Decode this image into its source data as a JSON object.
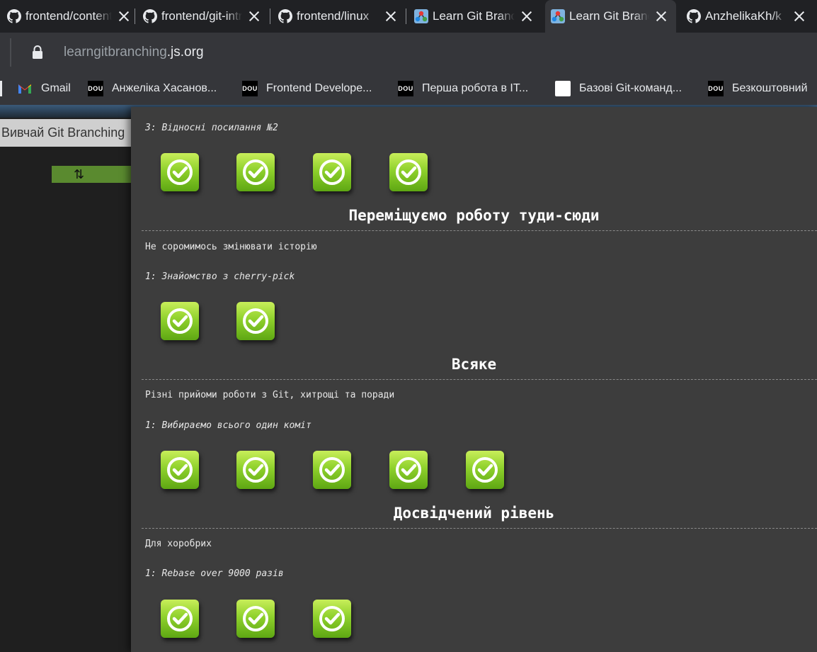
{
  "tabs": [
    {
      "title": "frontend/content",
      "icon": "github-icon",
      "active": false
    },
    {
      "title": "frontend/git-intro",
      "icon": "github-icon",
      "active": false
    },
    {
      "title": "frontend/linux",
      "icon": "github-icon",
      "active": false
    },
    {
      "title": "Learn Git Branching",
      "icon": "learngitbranching-icon",
      "active": false
    },
    {
      "title": "Learn Git Branching",
      "icon": "learngitbranching-icon",
      "active": true
    },
    {
      "title": "AnzhelikaKh/k",
      "icon": "github-icon",
      "active": false
    }
  ],
  "address": {
    "host": "learngitbranching",
    "domain": ".js.org"
  },
  "bookmarks": [
    {
      "label": "Gmail",
      "icon": "gmail-icon"
    },
    {
      "label": "Анжеліка Хасанов...",
      "icon": "dou-icon"
    },
    {
      "label": "Frontend Develope...",
      "icon": "dou-icon"
    },
    {
      "label": "Перша робота в IT...",
      "icon": "dou-icon"
    },
    {
      "label": "Базові Git-команд...",
      "icon": "document-icon"
    },
    {
      "label": "Безкоштовний",
      "icon": "dou-icon"
    }
  ],
  "dou_text": "DOU",
  "sidebar": {
    "title": "Вивчай Git Branching",
    "button_glyph": "⇅"
  },
  "panel": {
    "level_top": "3: Відносні посилання №2",
    "sections": [
      {
        "title": "Переміщуємо роботу туди-сюди",
        "desc": "Не соромимось змінювати історію",
        "level": "1: Знайомство з cherry-pick"
      },
      {
        "title": "Всяке",
        "desc": "Різні прийоми роботи з Git, хитрощі та поради",
        "level": "1: Вибираємо всього один коміт"
      },
      {
        "title": "Досвідчений рівень",
        "desc": "Для хоробрих",
        "level": "1: Rebase over 9000 разів"
      }
    ]
  },
  "colors": {
    "check_top": "#c8ee5a",
    "check_bottom": "#5ea713",
    "panel_bg": "#3d3d3d"
  }
}
